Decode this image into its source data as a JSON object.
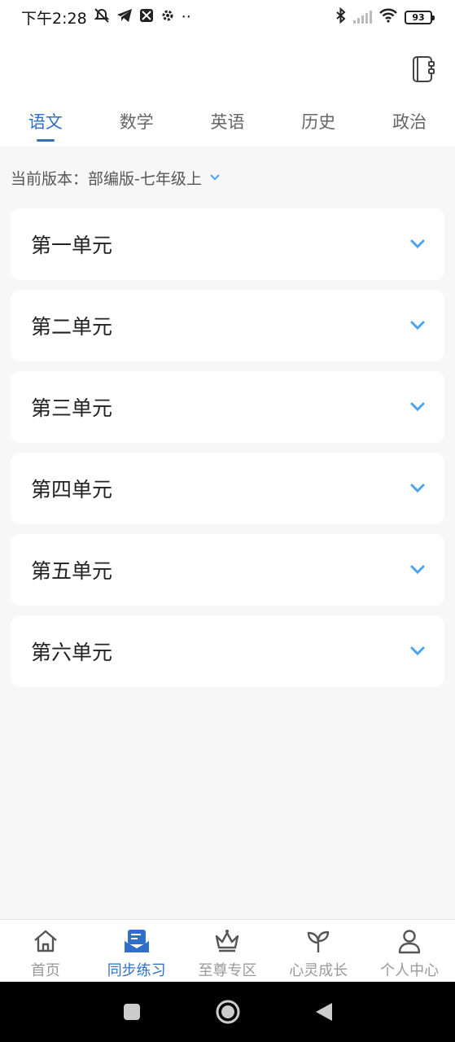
{
  "status_bar": {
    "time": "下午2:28",
    "battery": "93",
    "more_dots": "··",
    "icons": [
      "mute-bell-icon",
      "telegram-icon",
      "app-icon",
      "gear-icon",
      "bluetooth-icon",
      "signal-icon",
      "wifi-icon",
      "battery-icon"
    ]
  },
  "header": {
    "notebook_icon": "notebook-icon"
  },
  "tabs": [
    {
      "label": "语文",
      "active": true
    },
    {
      "label": "数学",
      "active": false
    },
    {
      "label": "英语",
      "active": false
    },
    {
      "label": "历史",
      "active": false
    },
    {
      "label": "政治",
      "active": false
    }
  ],
  "version": {
    "label": "当前版本：部编版-七年级上",
    "icon": "chevron-down-icon"
  },
  "units": [
    {
      "label": "第一单元"
    },
    {
      "label": "第二单元"
    },
    {
      "label": "第三单元"
    },
    {
      "label": "第四单元"
    },
    {
      "label": "第五单元"
    },
    {
      "label": "第六单元"
    }
  ],
  "bottom_nav": [
    {
      "label": "首页",
      "icon": "home-icon",
      "active": false
    },
    {
      "label": "同步练习",
      "icon": "practice-icon",
      "active": true
    },
    {
      "label": "至尊专区",
      "icon": "crown-icon",
      "active": false
    },
    {
      "label": "心灵成长",
      "icon": "sprout-icon",
      "active": false
    },
    {
      "label": "个人中心",
      "icon": "person-icon",
      "active": false
    }
  ],
  "colors": {
    "accent": "#2f6fc9",
    "chevron": "#4ba3f2",
    "background": "#f7f7f7",
    "card": "#ffffff"
  }
}
